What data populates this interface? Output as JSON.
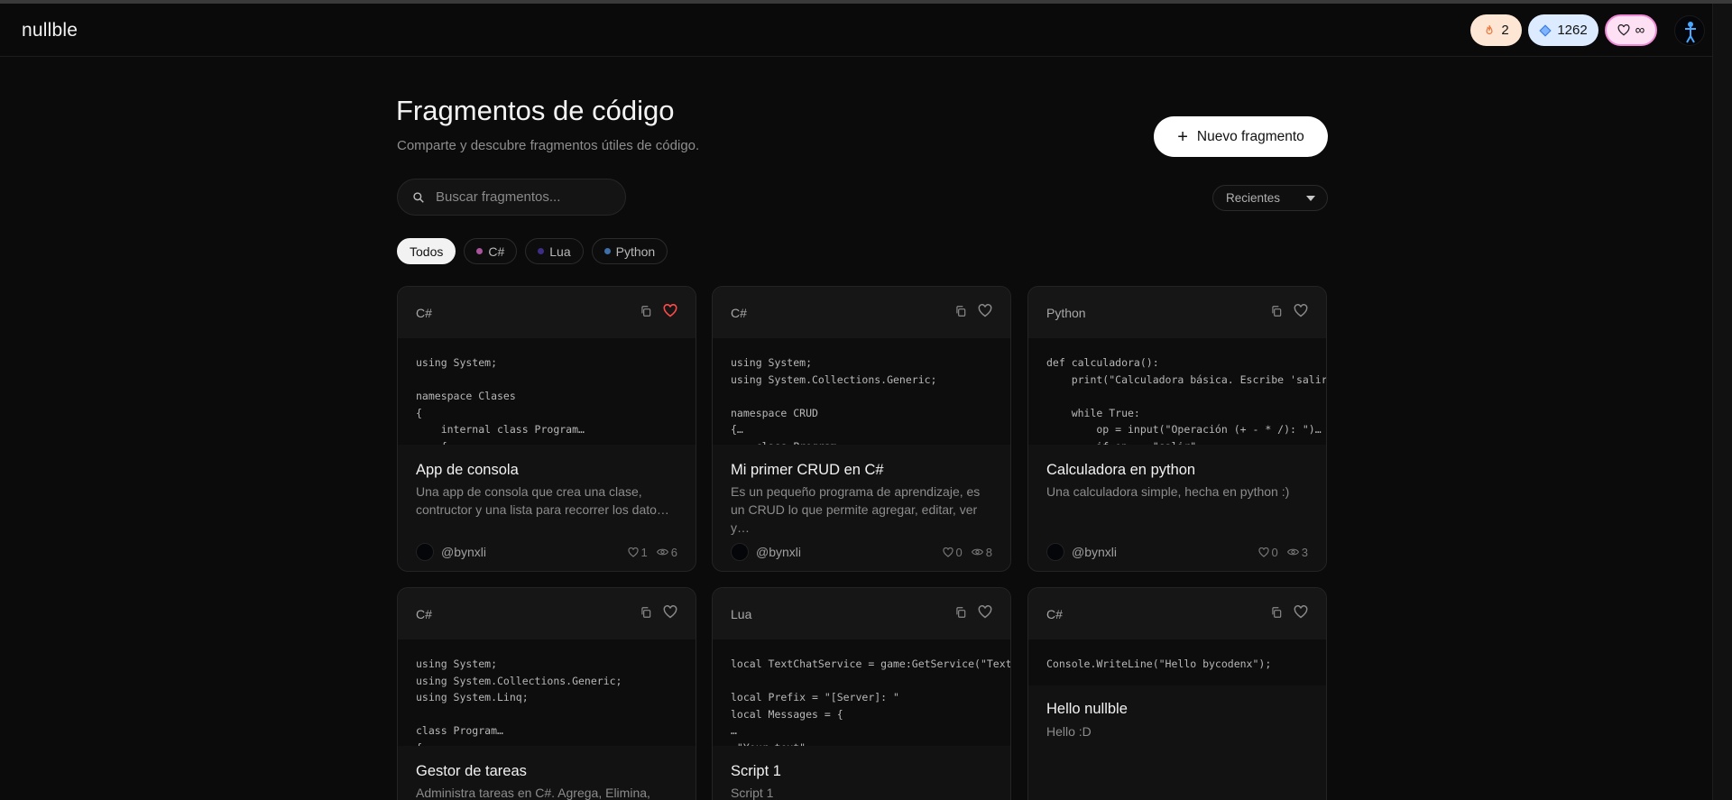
{
  "navbar": {
    "logo": "nullble",
    "streak": "2",
    "gems": "1262",
    "hearts": "∞"
  },
  "header": {
    "title": "Fragmentos de código",
    "subtitle": "Comparte y descubre fragmentos útiles de código.",
    "new_button": "Nuevo fragmento"
  },
  "search": {
    "placeholder": "Buscar fragmentos..."
  },
  "sort": {
    "selected": "Recientes"
  },
  "filters": [
    {
      "label": "Todos",
      "active": true
    },
    {
      "label": "C#",
      "color": "#a8559c"
    },
    {
      "label": "Lua",
      "color": "#3e2d86"
    },
    {
      "label": "Python",
      "color": "#3f6fa8"
    }
  ],
  "colors": {
    "liked_heart": "#ff4a4a"
  },
  "snippets": [
    {
      "lang": "C#",
      "liked": true,
      "code": "using System;\n\nnamespace Clases\n{\n    internal class Program…\n    {",
      "title": "App de consola",
      "description": "Una app de consola que crea una clase, contructor y una lista para recorrer los dato…",
      "author": "@bynxli",
      "likes": "1",
      "views": "6"
    },
    {
      "lang": "C#",
      "liked": false,
      "code": "using System;\nusing System.Collections.Generic;\n\nnamespace CRUD\n{…\n    class Program",
      "title": "Mi primer CRUD en C#",
      "description": "Es un pequeño programa de aprendizaje, es un CRUD lo que permite agregar, editar, ver y…",
      "author": "@bynxli",
      "likes": "0",
      "views": "8"
    },
    {
      "lang": "Python",
      "liked": false,
      "code": "def calculadora():\n    print(\"Calculadora básica. Escribe 'salir'\n\n    while True:\n        op = input(\"Operación (+ - * /): \")…\n        if op == \"salir\":",
      "title": "Calculadora en python",
      "description": "Una calculadora simple, hecha en python :)",
      "author": "@bynxli",
      "likes": "0",
      "views": "3"
    },
    {
      "lang": "C#",
      "liked": false,
      "code": "using System;\nusing System.Collections.Generic;\nusing System.Linq;\n\nclass Program…\n{",
      "title": "Gestor de tareas",
      "description": "Administra tareas en C#. Agrega, Elimina,"
    },
    {
      "lang": "Lua",
      "liked": false,
      "code": "local TextChatService = game:GetService(\"TextCha\n\nlocal Prefix = \"[Server]: \"\nlocal Messages = {\n…\n \"Your text\"",
      "title": "Script 1",
      "description": "Script 1"
    },
    {
      "lang": "C#",
      "liked": false,
      "code": "Console.WriteLine(\"Hello bycodenx\");",
      "title": "Hello nullble",
      "description": "Hello :D"
    }
  ]
}
